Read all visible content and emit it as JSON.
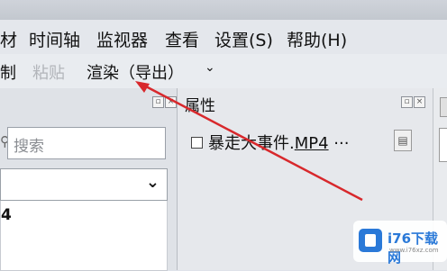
{
  "menu": {
    "items": [
      "材",
      "时间轴",
      "监视器",
      "查看",
      "设置(S)",
      "帮助(H)"
    ]
  },
  "toolbar": {
    "copy_label": "制",
    "paste_label": "粘贴",
    "render_label": "渲染（导出）",
    "more_icon": "chevron-down-icon"
  },
  "left_panel": {
    "search_placeholder": "搜索",
    "list_item": "4"
  },
  "properties": {
    "title": "属性",
    "file_name_prefix": "暴走大事件.",
    "file_name_ext": "MP4",
    "file_name_suffix": " ···"
  },
  "watermark": {
    "brand": "i76下载网",
    "sub": "www.i76xz.com"
  },
  "colors": {
    "arrow": "#d8282c",
    "accent": "#2a79d8"
  }
}
